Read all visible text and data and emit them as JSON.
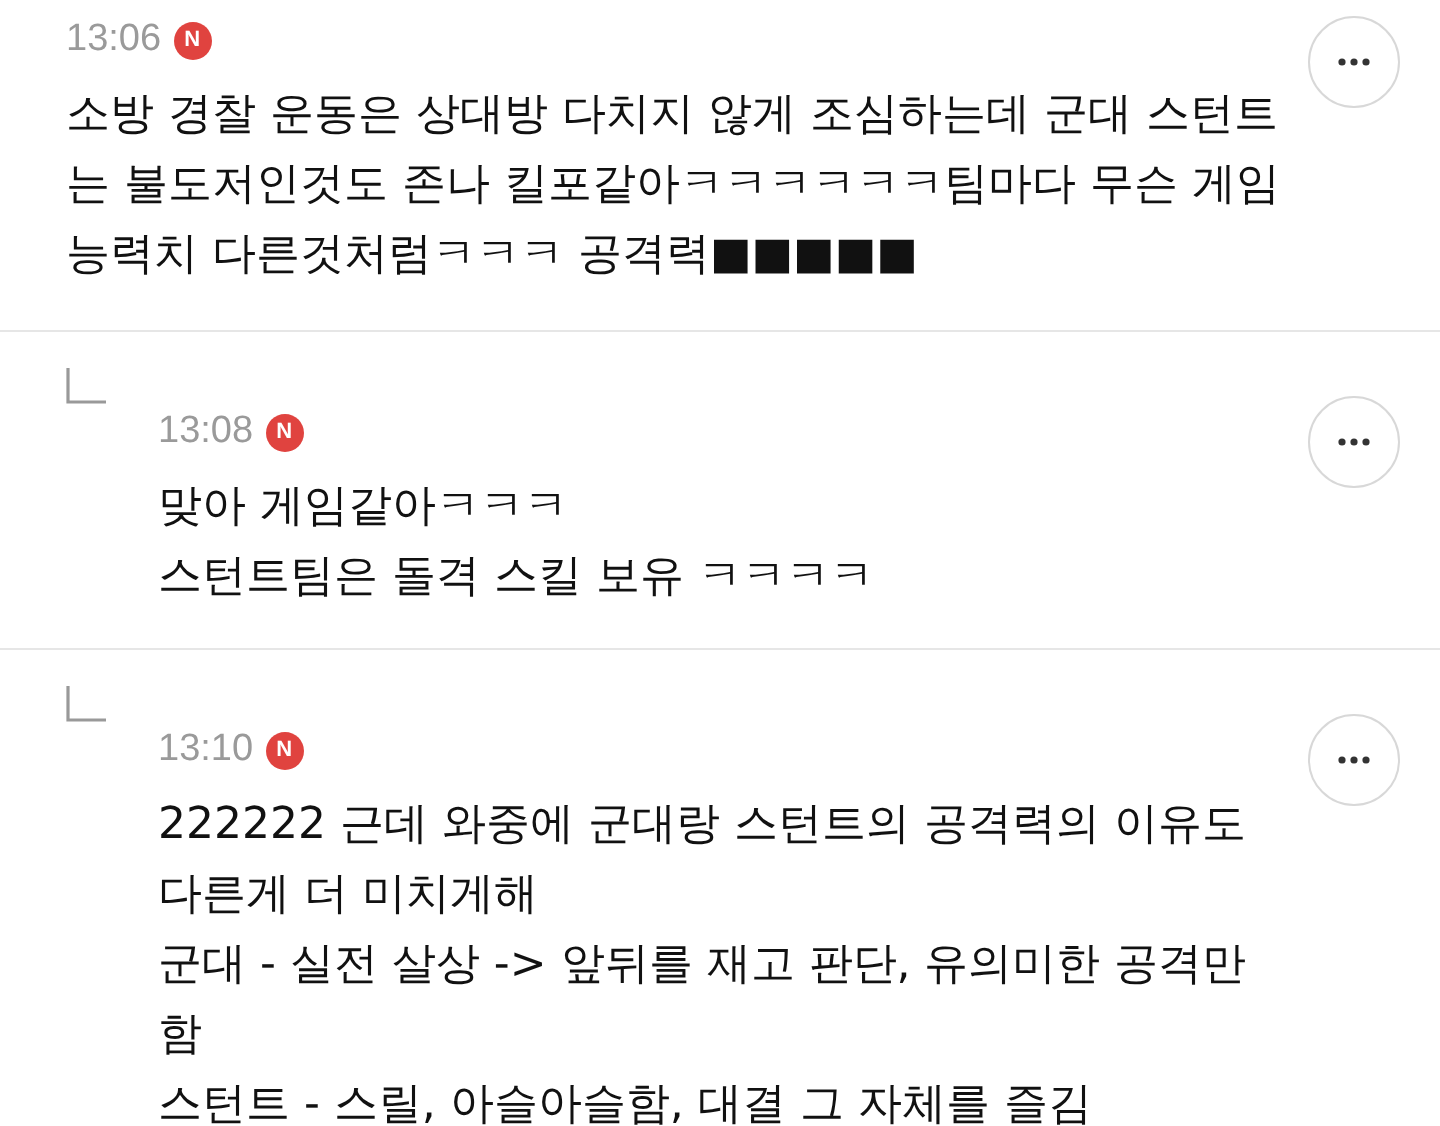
{
  "comments": [
    {
      "kind": "comment",
      "time": "13:06",
      "badge": "N",
      "lines": [
        "소방 경찰 운동은 상대방 다치지 않게 조심하는데 군대 스턴트",
        "는 불도저인것도 존나 킬포같아ㅋㅋㅋㅋㅋㅋ팀마다 무슨 게임",
        "능력치 다른것처럼ㅋㅋㅋ 공격력■■■■■"
      ]
    },
    {
      "kind": "reply",
      "time": "13:08",
      "badge": "N",
      "lines": [
        "맞아 게임같아ㅋㅋㅋ",
        "스턴트팀은 돌격 스킬 보유 ㅋㅋㅋㅋ"
      ]
    },
    {
      "kind": "reply",
      "time": "13:10",
      "badge": "N",
      "lines": [
        "222222 근데 와중에 군대랑 스턴트의 공격력의 이유도",
        "다른게 더 미치게해",
        "군대 - 실전 살상 -> 앞뒤를 재고 판단, 유의미한 공격만",
        "함",
        "스턴트 - 스릴, 아슬아슬함, 대결 그 자체를 즐김"
      ]
    }
  ]
}
